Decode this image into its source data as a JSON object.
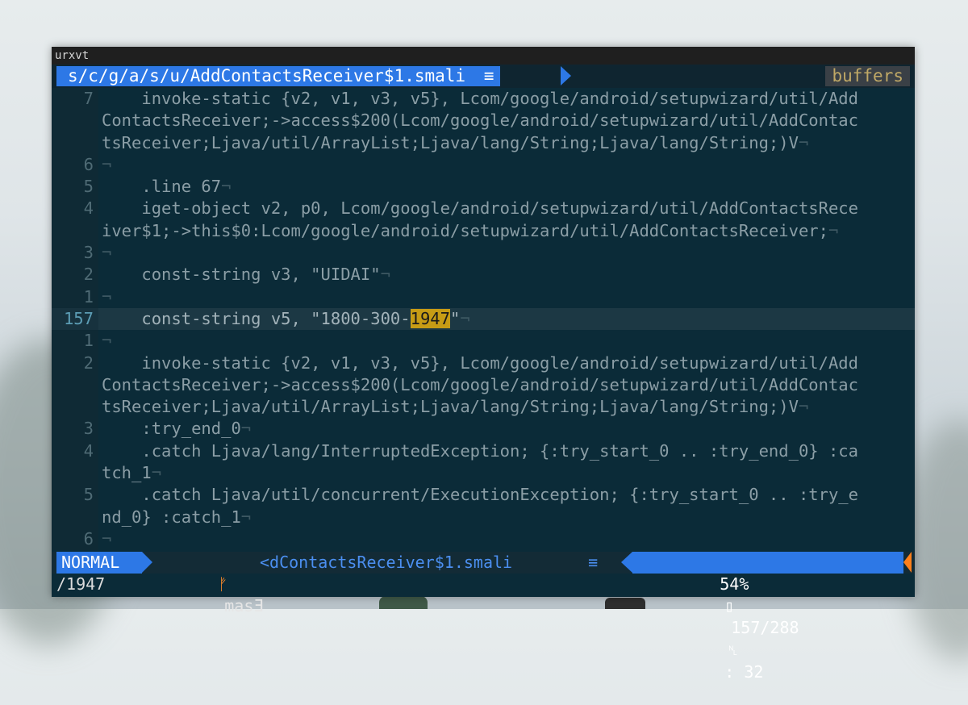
{
  "window": {
    "title": "urxvt"
  },
  "tabline": {
    "active_file": "s/c/g/a/s/u/AddContactsReceiver$1.smali",
    "active_icon": "≡",
    "buffers_label": "buffers"
  },
  "editor": {
    "lines": [
      {
        "num": "7",
        "text": "    invoke-static {v2, v1, v3, v5}, Lcom/google/android/setupwizard/util/Add",
        "eol": ""
      },
      {
        "num": "",
        "text": "ContactsReceiver;->access$200(Lcom/google/android/setupwizard/util/AddContac",
        "eol": ""
      },
      {
        "num": "",
        "text": "tsReceiver;Ljava/util/ArrayList;Ljava/lang/String;Ljava/lang/String;)V",
        "eol": "¬"
      },
      {
        "num": "6",
        "text": "",
        "eol": "¬"
      },
      {
        "num": "5",
        "text": "    .line 67",
        "eol": "¬"
      },
      {
        "num": "4",
        "text": "    iget-object v2, p0, Lcom/google/android/setupwizard/util/AddContactsRece",
        "eol": ""
      },
      {
        "num": "",
        "text": "iver$1;->this$0:Lcom/google/android/setupwizard/util/AddContactsReceiver;",
        "eol": "¬"
      },
      {
        "num": "3",
        "text": "",
        "eol": "¬"
      },
      {
        "num": "2",
        "text": "    const-string v3, \"UIDAI\"",
        "eol": "¬"
      },
      {
        "num": "1",
        "text": "",
        "eol": "¬"
      },
      {
        "num": "157",
        "text": "    const-string v5, \"1800-300-",
        "match": "1947",
        "after": "\"",
        "eol": "¬",
        "current": true
      },
      {
        "num": "1",
        "text": "",
        "eol": "¬"
      },
      {
        "num": "2",
        "text": "    invoke-static {v2, v1, v3, v5}, Lcom/google/android/setupwizard/util/Add",
        "eol": ""
      },
      {
        "num": "",
        "text": "ContactsReceiver;->access$200(Lcom/google/android/setupwizard/util/AddContac",
        "eol": ""
      },
      {
        "num": "",
        "text": "tsReceiver;Ljava/util/ArrayList;Ljava/lang/String;Ljava/lang/String;)V",
        "eol": "¬"
      },
      {
        "num": "3",
        "text": "    :try_end_0",
        "eol": "¬"
      },
      {
        "num": "4",
        "text": "    .catch Ljava/lang/InterruptedException; {:try_start_0 .. :try_end_0} :ca",
        "eol": ""
      },
      {
        "num": "",
        "text": "tch_1",
        "eol": "¬"
      },
      {
        "num": "5",
        "text": "    .catch Ljava/util/concurrent/ExecutionException; {:try_start_0 .. :try_e",
        "eol": ""
      },
      {
        "num": "",
        "text": "nd_0} :catch_1",
        "eol": "¬"
      },
      {
        "num": "6",
        "text": "",
        "eol": "¬"
      }
    ]
  },
  "statusline": {
    "mode": "NORMAL",
    "branch_icon": "ᚠ",
    "branch": "masƎ",
    "filename": "<dContactsReceiver$1.smali",
    "filetype_icon": "≡",
    "percent": "54%",
    "percent_icon": "▯",
    "position": "157/288",
    "ln_icon": "␤",
    "column": ": 32"
  },
  "cmdline": {
    "text": "/1947"
  },
  "colors": {
    "accent": "#2d78e6",
    "background": "#0b2b38",
    "search_match": "#c79c15",
    "branch_icon": "#ff8c2b"
  }
}
